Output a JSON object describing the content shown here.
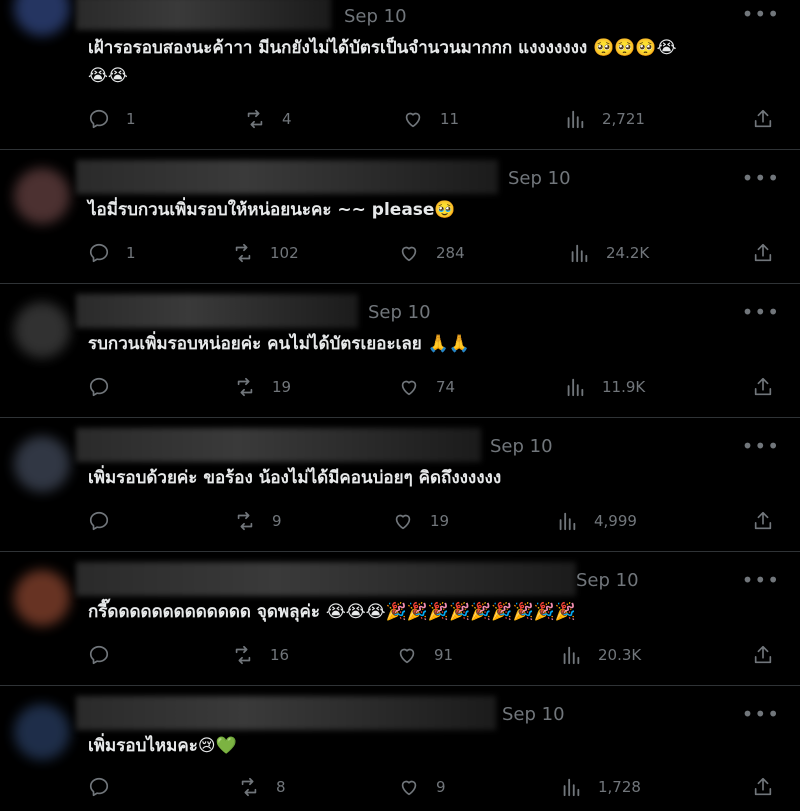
{
  "replies": [
    {
      "date": "Sep 10",
      "text_line1": "เฝ้ารอรอบสองนะค้าาา มีนกยังไม่ได้บัตรเป็นจำนวนมากกก แงงงงงงง 🥺🥺🥺😭",
      "text_line2": "😭😭",
      "replies": "1",
      "retweets": "4",
      "likes": "11",
      "views": "2,721",
      "avatar_color": "#2c3f73"
    },
    {
      "date": "Sep 10",
      "text_line1": "ไอมี่รบกวนเพิ่มรอบให้หน่อยนะคะ ~~ please🥹",
      "text_line2": "",
      "replies": "1",
      "retweets": "102",
      "likes": "284",
      "views": "24.2K",
      "avatar_color": "#5a3a3a"
    },
    {
      "date": "Sep 10",
      "text_line1": "รบกวนเพิ่มรอบหน่อยค่ะ คนไม่ได้บัตรเยอะเลย 🙏🙏",
      "text_line2": "",
      "replies": "",
      "retweets": "19",
      "likes": "74",
      "views": "11.9K",
      "avatar_color": "#3a3a3a"
    },
    {
      "date": "Sep 10",
      "text_line1": "เพิ่มรอบด้วยค่ะ ขอร้อง น้องไม่ได้มีคอนบ่อยๆ คิดถึงงงงงง",
      "text_line2": "",
      "replies": "",
      "retweets": "9",
      "likes": "19",
      "views": "4,999",
      "avatar_color": "#3a4150"
    },
    {
      "date": "Sep 10",
      "text_line1": "กรี๊ดดดดดดดดดดดดด จุดพลุค่ะ 😭😭😭🎉🎉🎉🎉🎉🎉🎉🎉🎉",
      "text_line2": "",
      "replies": "",
      "retweets": "16",
      "likes": "91",
      "views": "20.3K",
      "avatar_color": "#7a3d2a"
    },
    {
      "date": "Sep 10",
      "text_line1": "เพิ่มรอบไหมคะ😢💚",
      "text_line2": "",
      "replies": "",
      "retweets": "8",
      "likes": "9",
      "views": "1,728",
      "avatar_color": "#243656"
    }
  ],
  "icons": {
    "reply": "reply-icon",
    "retweet": "retweet-icon",
    "like": "heart-icon",
    "views": "views-icon",
    "share": "share-icon",
    "more": "more-icon"
  }
}
